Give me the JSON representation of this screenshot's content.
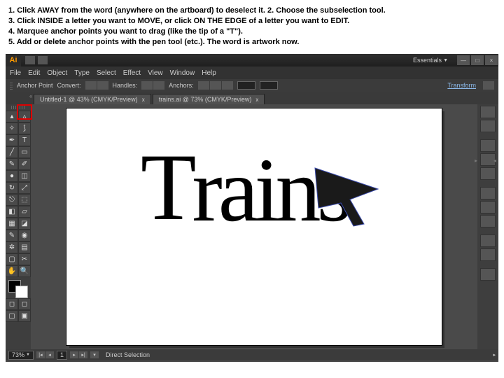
{
  "instructions": {
    "line1": "1. Click AWAY from the word (anywhere on the artboard) to deselect it. 2. Choose the subselection tool.",
    "line2": "3. Click INSIDE a letter you want to MOVE, or click ON THE EDGE of a letter you want to EDIT.",
    "line3": "4. Marquee anchor points you want to drag (like the tip of a \"T\").",
    "line4": "5. Add or delete anchor points with the pen tool (etc.). The word is artwork now."
  },
  "app": {
    "logo": "Ai",
    "workspace": "Essentials",
    "window_buttons": {
      "min": "—",
      "max": "□",
      "close": "×"
    }
  },
  "menu": {
    "file": "File",
    "edit": "Edit",
    "object": "Object",
    "type": "Type",
    "select": "Select",
    "effect": "Effect",
    "view": "View",
    "window": "Window",
    "help": "Help"
  },
  "control": {
    "mode": "Anchor Point",
    "convert_lbl": "Convert:",
    "handles_lbl": "Handles:",
    "anchors_lbl": "Anchors:",
    "val1": "",
    "val2": "",
    "transform": "Transform"
  },
  "tabs": {
    "t1": "Untitled-1 @ 43% (CMYK/Preview)",
    "t2": "trains.ai @ 73% (CMYK/Preview)",
    "close": "x"
  },
  "artwork_text": "Trains",
  "status": {
    "zoom": "73%",
    "artboard": "1",
    "tool": "Direct Selection"
  }
}
